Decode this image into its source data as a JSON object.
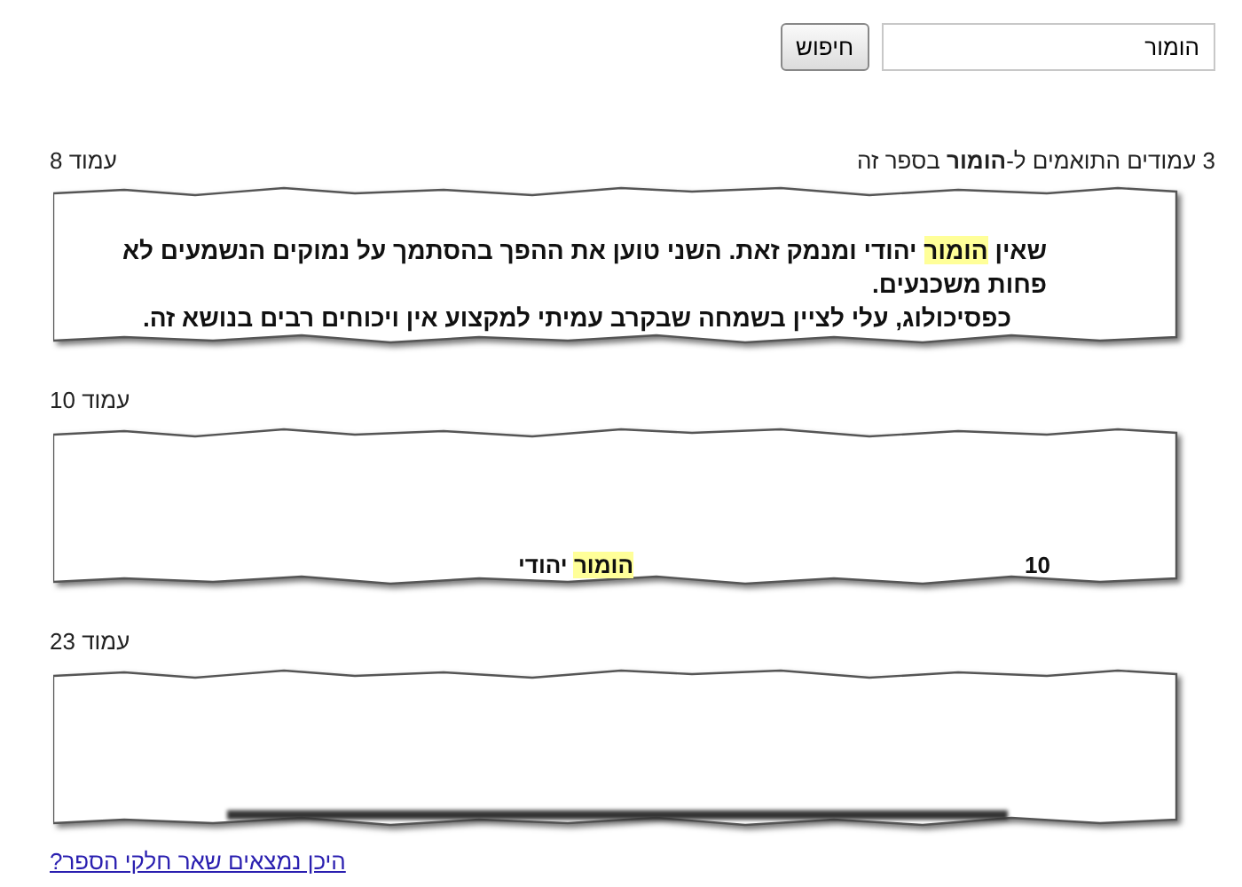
{
  "search": {
    "value": "הומור",
    "button": "חיפוש"
  },
  "summary": "3 עמודים התואמים ל-**הומור** בספר זה",
  "results": [
    {
      "label": "עמוד 8",
      "snippet": {
        "kind": "paragraph",
        "lines": [
          {
            "indent": false,
            "segments": [
              {
                "text": "שאין ",
                "highlight": false
              },
              {
                "text": "הומור",
                "highlight": true
              },
              {
                "text": " יהודי ומנמק זאת. השני טוען את ההפך בהסתמך על נמוקים הנשמעים לא",
                "highlight": false
              }
            ]
          },
          {
            "indent": false,
            "segments": [
              {
                "text": "פחות משכנעים.",
                "highlight": false
              }
            ]
          },
          {
            "indent": true,
            "segments": [
              {
                "text": "כפסיכולוג, עלי לציין בשמחה שבקרב עמיתי למקצוע אין ויכוחים רבים בנושא זה.",
                "highlight": false
              }
            ]
          }
        ]
      }
    },
    {
      "label": "עמוד 10",
      "snippet": {
        "kind": "running_head",
        "page_number": "10",
        "title": [
          {
            "text": "הומור",
            "highlight": true
          },
          {
            "text": " יהודי",
            "highlight": false
          }
        ]
      }
    },
    {
      "label": "עמוד 23",
      "snippet": {
        "kind": "cut_off"
      }
    }
  ],
  "link": "היכן נמצאים שאר חלקי הספר?"
}
